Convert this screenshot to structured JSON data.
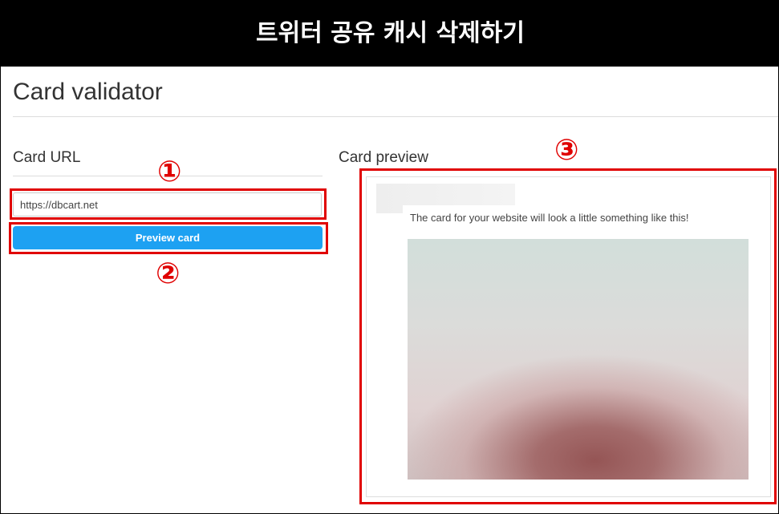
{
  "banner": {
    "title": "트위터 공유 캐시 삭제하기"
  },
  "page": {
    "heading": "Card validator"
  },
  "left": {
    "section_title": "Card URL",
    "url_value": "https://dbcart.net",
    "button_label": "Preview card"
  },
  "right": {
    "section_title": "Card preview",
    "card_text": "The card for your website will look a little something like this!"
  },
  "annotations": {
    "one": "①",
    "two": "②",
    "three": "③",
    "color": "#e00000"
  },
  "colors": {
    "button": "#1da1f2",
    "banner_bg": "#000000"
  }
}
